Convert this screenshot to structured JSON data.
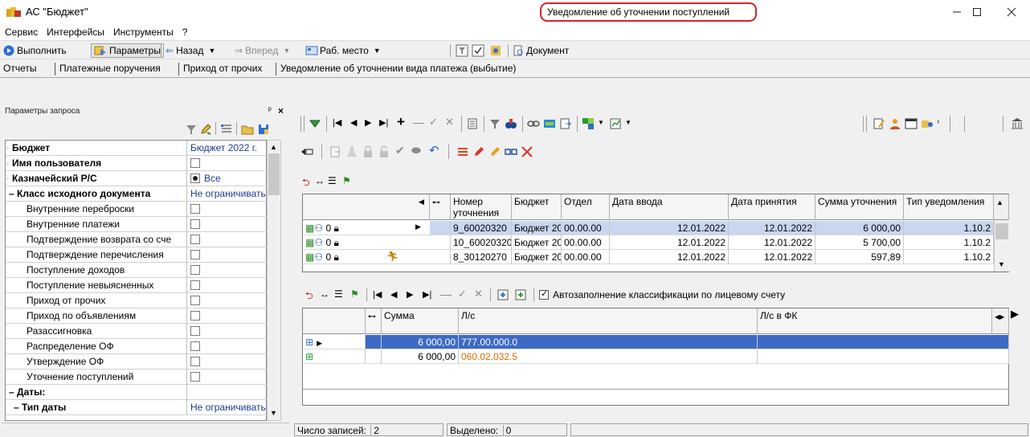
{
  "window": {
    "title": "АС \"Бюджет\""
  },
  "menu": [
    "Сервис",
    "Интерфейсы",
    "Инструменты",
    "?"
  ],
  "toolbar": {
    "run": "Выполнить",
    "params": "Параметры",
    "back": "Назад",
    "forward": "Вперед",
    "workplace": "Раб. место",
    "document": "Документ"
  },
  "tabs": [
    "Отчеты",
    "Платежные поручения",
    "Приход от прочих",
    "Уведомление об уточнении вида платежа (выбытие)"
  ],
  "active_tab": "Уведомление об уточнении поступлений",
  "left_panel": {
    "title": "Параметры запроса",
    "rows": [
      {
        "label": "Бюджет",
        "value": "Бюджет 2022 г."
      },
      {
        "label": "Имя пользователя",
        "value": ""
      },
      {
        "label": "Казначейский Р/С",
        "value": "Все"
      },
      {
        "label": "Класс исходного документа",
        "value": "Не ограничивать"
      },
      {
        "label": "Внутренние переброски",
        "value": ""
      },
      {
        "label": "Внутренние платежи",
        "value": ""
      },
      {
        "label": "Подтверждение возврата со сче",
        "value": ""
      },
      {
        "label": "Подтверждение перечисления",
        "value": ""
      },
      {
        "label": "Поступление доходов",
        "value": ""
      },
      {
        "label": "Поступление невыясненных",
        "value": ""
      },
      {
        "label": "Приход от прочих",
        "value": ""
      },
      {
        "label": "Приход по объявлениям",
        "value": ""
      },
      {
        "label": "Разассигновка",
        "value": ""
      },
      {
        "label": "Распределение ОФ",
        "value": ""
      },
      {
        "label": "Утверждение ОФ",
        "value": ""
      },
      {
        "label": "Уточнение поступлений",
        "value": ""
      },
      {
        "label": "Даты:",
        "value": ""
      },
      {
        "label": "Тип даты",
        "value": "Не ограничивать"
      }
    ]
  },
  "grid1": {
    "columns": [
      "Номер уточнения",
      "Бюджет",
      "Отдел",
      "Дата ввода",
      "Дата принятия",
      "Сумма уточнения",
      "Тип уведомления"
    ],
    "rows": [
      [
        "9_60020320",
        "Бюджет 20",
        "00.00.00",
        "12.01.2022",
        "12.01.2022",
        "6 000,00",
        "1.10.2"
      ],
      [
        "10_60020320",
        "Бюджет 20",
        "00.00.00",
        "12.01.2022",
        "12.01.2022",
        "5 700,00",
        "1.10.2"
      ],
      [
        "8_30120270",
        "Бюджет 20",
        "00.00.00",
        "12.01.2022",
        "12.01.2022",
        "597,89",
        "1.10.2"
      ]
    ]
  },
  "grid2": {
    "autofill_label": "Автозаполнение классификации по лицевому счету",
    "columns": [
      "Сумма",
      "Л/с",
      "Л/с в ФК"
    ],
    "rows": [
      [
        "6 000,00",
        "777.00.000.0",
        ""
      ],
      [
        "6 000,00",
        "060.02.032.5",
        ""
      ]
    ]
  },
  "status": {
    "records_label": "Число записей:",
    "records": "2",
    "selected_label": "Выделено:",
    "selected": "0"
  },
  "colors": {
    "selection": "#3c6ac4",
    "highlight": "#d9232e",
    "link_orange": "#e06a00"
  }
}
